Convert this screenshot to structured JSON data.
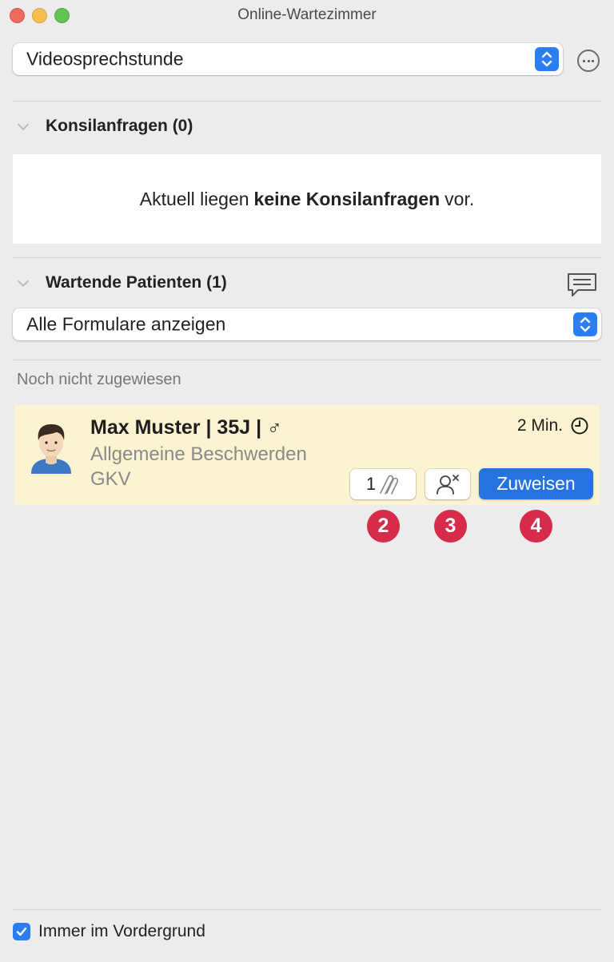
{
  "window": {
    "title": "Online-Wartezimmer"
  },
  "room_select": {
    "value": "Videosprechstunde"
  },
  "consultations": {
    "header": "Konsilanfragen (0)",
    "empty_prefix": "Aktuell liegen",
    "empty_bold": "keine Konsilanfragen",
    "empty_suffix": "vor."
  },
  "waiting": {
    "header": "Wartende Patienten (1)",
    "filter_value": "Alle Formulare anzeigen",
    "group_label": "Noch nicht zugewiesen"
  },
  "patient": {
    "name": "Max Muster | 35J |",
    "gender_symbol": "♂",
    "reason": "Allgemeine Beschwerden",
    "insurance": "GKV",
    "wait_time": "2 Min.",
    "attachment_count": "1",
    "assign_label": "Zuweisen"
  },
  "markers": [
    "2",
    "3",
    "4"
  ],
  "footer": {
    "always_on_top_label": "Immer im Vordergrund",
    "always_on_top_checked": true
  },
  "icons": [
    "chevron-down-icon",
    "more-icon",
    "chat-icon",
    "clock-icon",
    "paperclip-icon",
    "remove-person-icon",
    "checkmark-icon"
  ],
  "colors": {
    "accent": "#2a7ef2",
    "card_bg": "#fcf3d2",
    "marker": "#d62b49",
    "assign_button": "#2573e0"
  }
}
